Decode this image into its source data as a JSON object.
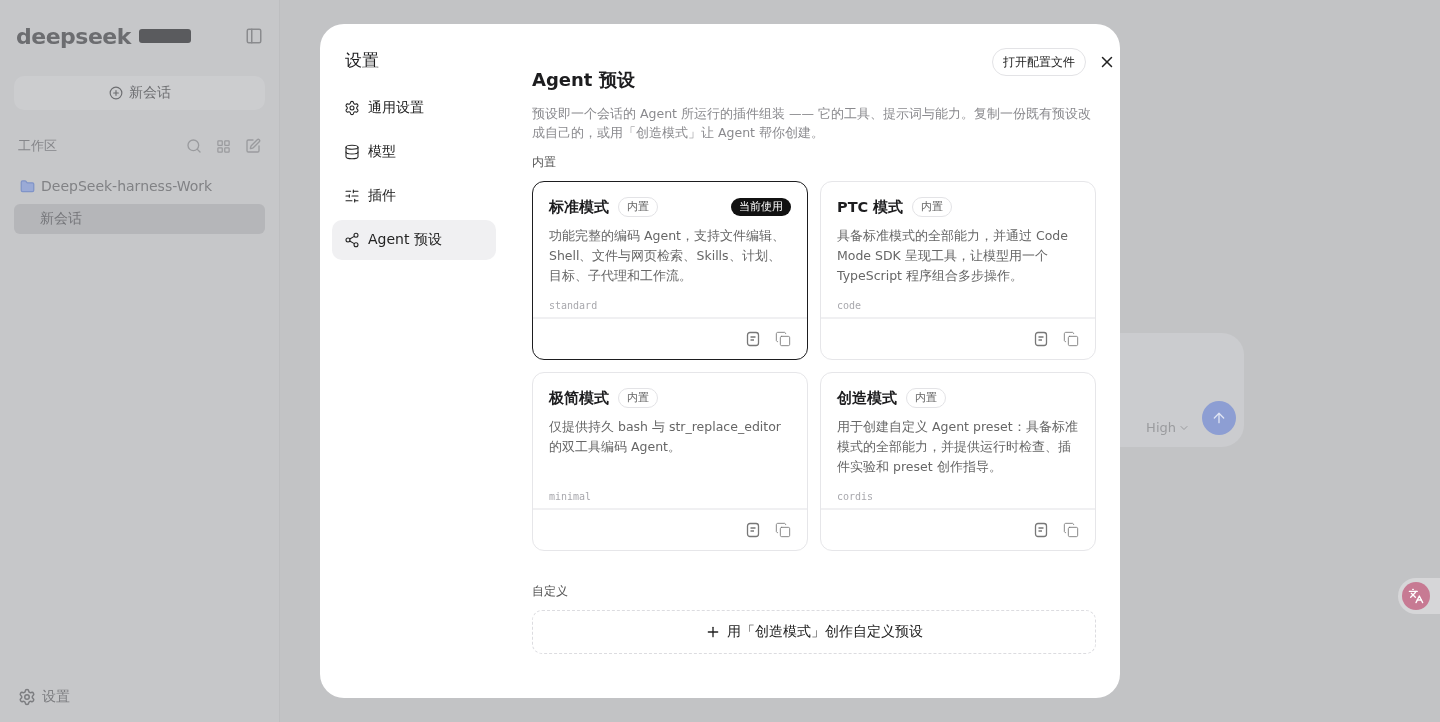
{
  "sidebar": {
    "logo": "deepseek",
    "new_chat": "新会话",
    "workspace_label": "工作区",
    "project": "DeepSeek-harness-Work",
    "sessions": [
      {
        "label": "新会话",
        "selected": true
      }
    ],
    "settings": "设置"
  },
  "composer": {
    "effort": "High"
  },
  "dialog": {
    "title": "设置",
    "nav": [
      {
        "label": "通用设置",
        "selected": false
      },
      {
        "label": "模型",
        "selected": false
      },
      {
        "label": "插件",
        "selected": false
      },
      {
        "label": "Agent 预设",
        "selected": true
      }
    ],
    "open_config": "打开配置文件",
    "heading": "Agent 预设",
    "description": "预设即一个会话的 Agent 所运行的插件组装 —— 它的工具、提示词与能力。复制一份既有预设改成自己的，或用「创造模式」让 Agent 帮你创建。",
    "builtin_label": "内置",
    "presets": [
      {
        "name": "标准模式",
        "tag": "内置",
        "badge": "当前使用",
        "selected": true,
        "description": "功能完整的编码 Agent，支持文件编辑、Shell、文件与网页检索、Skills、计划、目标、子代理和工作流。",
        "id": "standard"
      },
      {
        "name": "PTC 模式",
        "tag": "内置",
        "selected": false,
        "description": "具备标准模式的全部能力，并通过 Code Mode SDK 呈现工具，让模型用一个 TypeScript 程序组合多步操作。",
        "id": "code"
      },
      {
        "name": "极简模式",
        "tag": "内置",
        "selected": false,
        "description": "仅提供持久 bash 与 str_replace_editor 的双工具编码 Agent。",
        "id": "minimal"
      },
      {
        "name": "创造模式",
        "tag": "内置",
        "selected": false,
        "description": "用于创建自定义 Agent preset：具备标准模式的全部能力，并提供运行时检查、插件实验和 preset 创作指导。",
        "id": "cordis"
      }
    ],
    "custom_label": "自定义",
    "create_button": "用「创造模式」创作自定义预设"
  }
}
